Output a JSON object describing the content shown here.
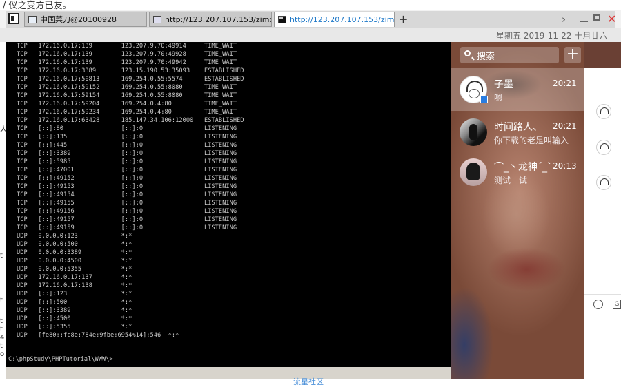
{
  "top_strip_text": "/ 仪之变方已友。",
  "tabs": [
    {
      "label": "中国菜刀@20100928",
      "icon": "window-icon"
    },
    {
      "label": "http://123.207.107.153/zimo....",
      "icon": "folder-icon"
    },
    {
      "label": "http://123.207.107.153/zimo....",
      "icon": "terminal-icon",
      "active": true
    }
  ],
  "new_tab_label": "+",
  "date_text": "星期五 2019-11-22 十月廿六",
  "console": {
    "rows": [
      [
        "TCP",
        "172.16.0.17:139",
        "123.207.9.70:49914",
        "TIME_WAIT"
      ],
      [
        "TCP",
        "172.16.0.17:139",
        "123.207.9.70:49928",
        "TIME_WAIT"
      ],
      [
        "TCP",
        "172.16.0.17:139",
        "123.207.9.70:49942",
        "TIME_WAIT"
      ],
      [
        "TCP",
        "172.16.0.17:3389",
        "123.15.190.53:35093",
        "ESTABLISHED"
      ],
      [
        "TCP",
        "172.16.0.17:50813",
        "169.254.0.55:5574",
        "ESTABLISHED"
      ],
      [
        "TCP",
        "172.16.0.17:59152",
        "169.254.0.55:8080",
        "TIME_WAIT"
      ],
      [
        "TCP",
        "172.16.0.17:59154",
        "169.254.0.55:8080",
        "TIME_WAIT"
      ],
      [
        "TCP",
        "172.16.0.17:59204",
        "169.254.0.4:80",
        "TIME_WAIT"
      ],
      [
        "TCP",
        "172.16.0.17:59234",
        "169.254.0.4:80",
        "TIME_WAIT"
      ],
      [
        "TCP",
        "172.16.0.17:63428",
        "185.147.34.106:12000",
        "ESTABLISHED"
      ],
      [
        "TCP",
        "[::]:80",
        "[::]:0",
        "LISTENING"
      ],
      [
        "TCP",
        "[::]:135",
        "[::]:0",
        "LISTENING"
      ],
      [
        "TCP",
        "[::]:445",
        "[::]:0",
        "LISTENING"
      ],
      [
        "TCP",
        "[::]:3389",
        "[::]:0",
        "LISTENING"
      ],
      [
        "TCP",
        "[::]:5985",
        "[::]:0",
        "LISTENING"
      ],
      [
        "TCP",
        "[::]:47001",
        "[::]:0",
        "LISTENING"
      ],
      [
        "TCP",
        "[::]:49152",
        "[::]:0",
        "LISTENING"
      ],
      [
        "TCP",
        "[::]:49153",
        "[::]:0",
        "LISTENING"
      ],
      [
        "TCP",
        "[::]:49154",
        "[::]:0",
        "LISTENING"
      ],
      [
        "TCP",
        "[::]:49155",
        "[::]:0",
        "LISTENING"
      ],
      [
        "TCP",
        "[::]:49156",
        "[::]:0",
        "LISTENING"
      ],
      [
        "TCP",
        "[::]:49157",
        "[::]:0",
        "LISTENING"
      ],
      [
        "TCP",
        "[::]:49159",
        "[::]:0",
        "LISTENING"
      ],
      [
        "UDP",
        "0.0.0.0:123",
        "*:*",
        ""
      ],
      [
        "UDP",
        "0.0.0.0:500",
        "*:*",
        ""
      ],
      [
        "UDP",
        "0.0.0.0:3389",
        "*:*",
        ""
      ],
      [
        "UDP",
        "0.0.0.0:4500",
        "*:*",
        ""
      ],
      [
        "UDP",
        "0.0.0.0:5355",
        "*:*",
        ""
      ],
      [
        "UDP",
        "172.16.0.17:137",
        "*:*",
        ""
      ],
      [
        "UDP",
        "172.16.0.17:138",
        "*:*",
        ""
      ],
      [
        "UDP",
        "[::]:123",
        "*:*",
        ""
      ],
      [
        "UDP",
        "[::]:500",
        "*:*",
        ""
      ],
      [
        "UDP",
        "[::]:3389",
        "*:*",
        ""
      ],
      [
        "UDP",
        "[::]:4500",
        "*:*",
        ""
      ],
      [
        "UDP",
        "[::]:5355",
        "*:*",
        ""
      ],
      [
        "UDP",
        "[fe80::fc8e:784e:9fbe:6954%14]:546",
        "*:*",
        ""
      ]
    ],
    "prompt": "C:\\phpStudy\\PHPTutorial\\WWW\\>"
  },
  "left_strip_chars": [
    "人",
    "t",
    "t",
    "t",
    "t",
    "4",
    "t",
    "o"
  ],
  "qq": {
    "search_placeholder": "搜索",
    "add_label": "+",
    "chats": [
      {
        "name": "子墨",
        "time": "20:21",
        "message": "嗯",
        "avatar": "sketch-avatar",
        "selected": true
      },
      {
        "name": "时间路人、",
        "time": "20:21",
        "message": "你下载的老是叫输入",
        "avatar": "dark-avatar"
      },
      {
        "name": "⌒_丶龙神ˊ_ˋ",
        "time": "20:13",
        "message": "测试一试",
        "avatar": "anime-avatar"
      }
    ]
  },
  "right_panel": {
    "input_tool_g": "G"
  },
  "footer_text": "流星社区"
}
